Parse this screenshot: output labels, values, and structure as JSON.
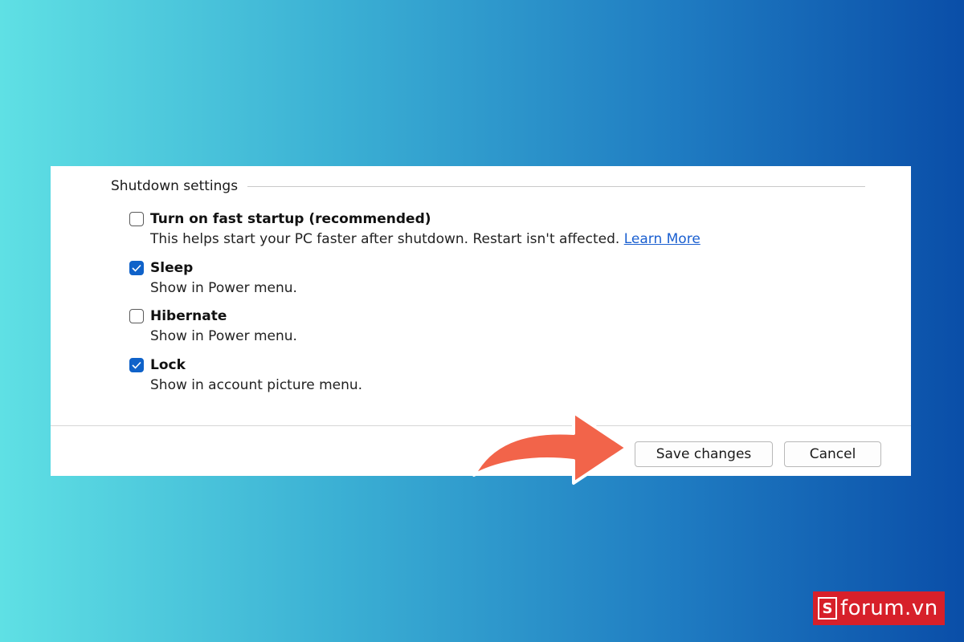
{
  "section": {
    "title": "Shutdown settings"
  },
  "options": [
    {
      "label": "Turn on fast startup (recommended)",
      "checked": false,
      "description": "This helps start your PC faster after shutdown. Restart isn't affected.",
      "link": "Learn More"
    },
    {
      "label": "Sleep",
      "checked": true,
      "description": "Show in Power menu."
    },
    {
      "label": "Hibernate",
      "checked": false,
      "description": "Show in Power menu."
    },
    {
      "label": "Lock",
      "checked": true,
      "description": "Show in account picture menu."
    }
  ],
  "buttons": {
    "save": "Save changes",
    "cancel": "Cancel"
  },
  "brand": {
    "mark": "S",
    "text": "forum.vn"
  },
  "colors": {
    "accent": "#0f62c9",
    "link": "#1a5fd0",
    "arrow": "#f2644a",
    "brand": "#d7202a"
  },
  "icons": {
    "checkmark": "checkmark-icon",
    "arrow": "curved-arrow-icon"
  }
}
